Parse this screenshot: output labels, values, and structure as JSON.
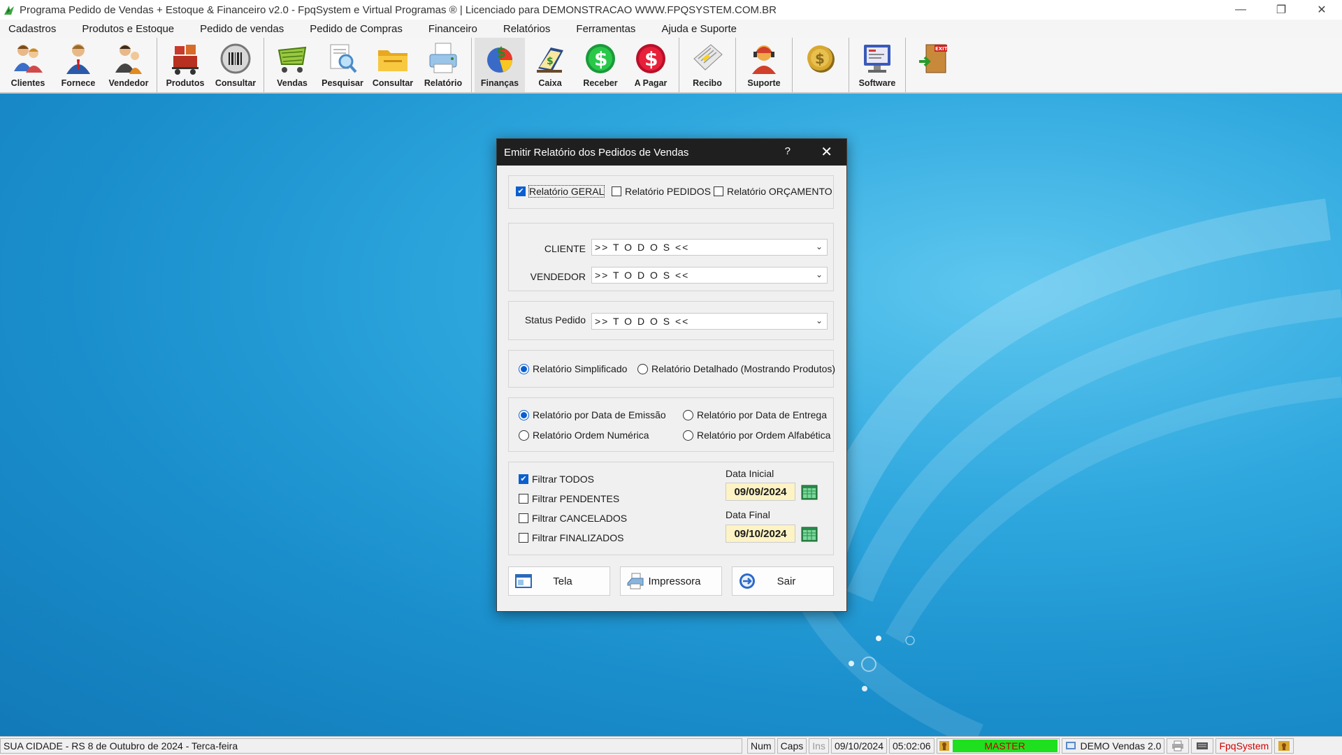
{
  "window": {
    "title": "Programa Pedido de Vendas + Estoque & Financeiro v2.0 - FpqSystem e Virtual Programas ® | Licenciado para  DEMONSTRACAO WWW.FPQSYSTEM.COM.BR",
    "minimize": "—",
    "restore": "❐",
    "close": "✕"
  },
  "menu": [
    "Cadastros",
    "Produtos e Estoque",
    "Pedido de vendas",
    "Pedido de Compras",
    "Financeiro",
    "Relatórios",
    "Ferramentas",
    "Ajuda e Suporte"
  ],
  "toolbar": {
    "clientes": "Clientes",
    "fornece": "Fornece",
    "vendedor": "Vendedor",
    "produtos": "Produtos",
    "consultar1": "Consultar",
    "vendas": "Vendas",
    "pesquisar": "Pesquisar",
    "consultar2": "Consultar",
    "relatorio": "Relatório",
    "financas": "Finanças",
    "caixa": "Caixa",
    "receber": "Receber",
    "apagar": "A Pagar",
    "recibo": "Recibo",
    "suporte": "Suporte",
    "software": "Software",
    "exit_badge": "EXIT"
  },
  "dialog": {
    "title": "Emitir Relatório dos Pedidos de Vendas",
    "help": "?",
    "close": "✕",
    "report_types": {
      "geral": "Relatório GERAL",
      "pedidos": "Relatório PEDIDOS",
      "orcamento": "Relatório ORÇAMENTO",
      "geral_checked": true,
      "pedidos_checked": false,
      "orcamento_checked": false
    },
    "cliente_label": "CLIENTE",
    "cliente_value": ">> T O D O S <<",
    "vendedor_label": "VENDEDOR",
    "vendedor_value": ">> T O D O S <<",
    "status_label": "Status Pedido",
    "status_value": ">> T O D O S <<",
    "detail": {
      "simplificado": "Relatório Simplificado",
      "detalhado": "Relatório Detalhado (Mostrando Produtos)",
      "selected": "simplificado"
    },
    "ordering": {
      "emissao": "Relatório por Data de Emissão",
      "entrega": "Relatório por Data de Entrega",
      "numerica": "Relatório Ordem Numérica",
      "alfabetica": "Relatório por Ordem Alfabética",
      "selected": "emissao"
    },
    "filters": {
      "todos": "Filtrar TODOS",
      "pendentes": "Filtrar PENDENTES",
      "cancelados": "Filtrar CANCELADOS",
      "finalizados": "Filtrar FINALIZADOS",
      "todos_checked": true
    },
    "data_inicial_label": "Data Inicial",
    "data_inicial": "09/09/2024",
    "data_final_label": "Data Final",
    "data_final": "09/10/2024",
    "btn_tela": "Tela",
    "btn_impressora": "Impressora",
    "btn_sair": "Sair"
  },
  "status": {
    "city_date": "SUA CIDADE - RS  8 de Outubro de 2024 - Terca-feira",
    "num": "Num",
    "caps": "Caps",
    "ins": "Ins",
    "date": "09/10/2024",
    "time": "05:02:06",
    "user": "MASTER",
    "product": "DEMO Vendas 2.0",
    "brand": "FpqSystem"
  },
  "colors": {
    "accent": "#0a5fd0",
    "date_bg": "#fdf3c4",
    "master_bg": "#1ee01e",
    "master_text": "#c00000",
    "desktop": "#1a8fcc"
  }
}
